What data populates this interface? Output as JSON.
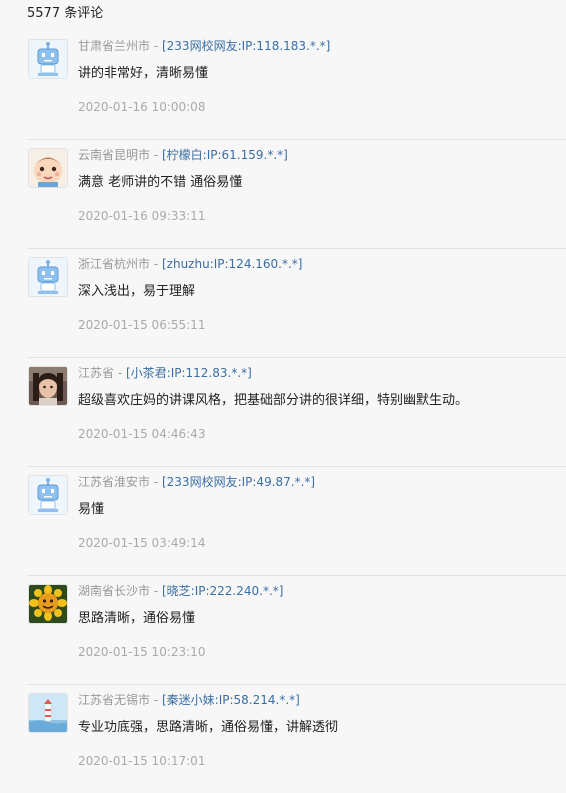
{
  "header": {
    "count_label": "5577 条评论"
  },
  "comments": [
    {
      "location": "甘肃省兰州市",
      "sep": " - ",
      "user": "[233网校网友:IP:118.183.*.*]",
      "content": "讲的非常好，清晰易懂",
      "time": "2020-01-16 10:00:08",
      "avatar": "robot-avatar-icon"
    },
    {
      "location": "云南省昆明市",
      "sep": " - ",
      "user": "[柠檬白:IP:61.159.*.*]",
      "content": "满意 老师讲的不错 通俗易懂",
      "time": "2020-01-16 09:33:11",
      "avatar": "baby-face-avatar-icon"
    },
    {
      "location": "浙江省杭州市",
      "sep": " - ",
      "user": "[zhuzhu:IP:124.160.*.*]",
      "content": "深入浅出，易于理解",
      "time": "2020-01-15 06:55:11",
      "avatar": "robot-avatar-icon"
    },
    {
      "location": "江苏省",
      "sep": " - ",
      "user": "[小茶君:IP:112.83.*.*]",
      "content": "超级喜欢庄妈的讲课风格，把基础部分讲的很详细，特别幽默生动。",
      "time": "2020-01-15 04:46:43",
      "avatar": "photo-avatar-icon"
    },
    {
      "location": "江苏省淮安市",
      "sep": " - ",
      "user": "[233网校网友:IP:49.87.*.*]",
      "content": "易懂",
      "time": "2020-01-15 03:49:14",
      "avatar": "robot-avatar-icon"
    },
    {
      "location": "湖南省长沙市",
      "sep": " - ",
      "user": "[晓芝:IP:222.240.*.*]",
      "content": "思路清晰，通俗易懂",
      "time": "2020-01-15 10:23:10",
      "avatar": "sunflower-avatar-icon"
    },
    {
      "location": "江苏省无锡市",
      "sep": " - ",
      "user": "[秦迷小妹:IP:58.214.*.*]",
      "content": "专业功底强，思路清晰，通俗易懂，讲解透彻",
      "time": "2020-01-15 10:17:01",
      "avatar": "lighthouse-avatar-icon"
    }
  ]
}
